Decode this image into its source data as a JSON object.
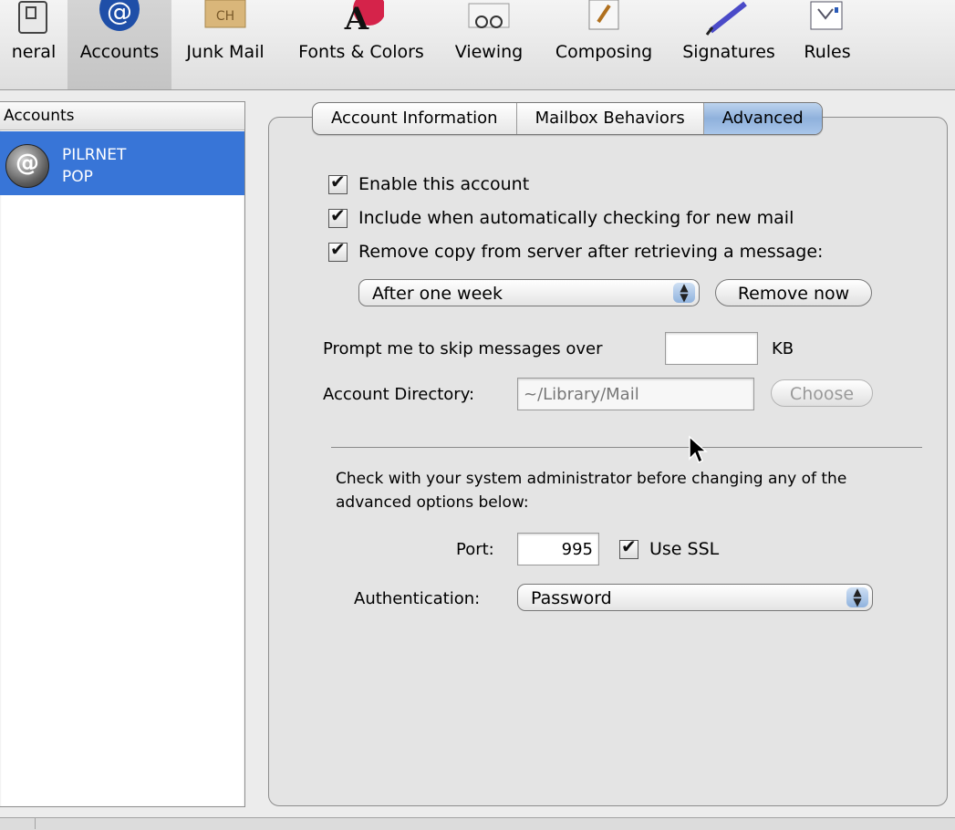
{
  "toolbar": {
    "items": [
      {
        "label": "neral",
        "icon": "general-icon"
      },
      {
        "label": "Accounts",
        "icon": "at-sign-icon",
        "selected": true
      },
      {
        "label": "Junk Mail",
        "icon": "junk-mail-icon"
      },
      {
        "label": "Fonts & Colors",
        "icon": "fonts-colors-icon"
      },
      {
        "label": "Viewing",
        "icon": "glasses-icon"
      },
      {
        "label": "Composing",
        "icon": "pencil-icon"
      },
      {
        "label": "Signatures",
        "icon": "pen-icon"
      },
      {
        "label": "Rules",
        "icon": "rules-icon"
      }
    ]
  },
  "accounts": {
    "header": "Accounts",
    "list": [
      {
        "name": "PILRNET",
        "type": "POP",
        "icon": "at-sign-icon"
      }
    ]
  },
  "tabs": [
    {
      "label": "Account Information"
    },
    {
      "label": "Mailbox Behaviors"
    },
    {
      "label": "Advanced",
      "selected": true
    }
  ],
  "advanced": {
    "enable_account": {
      "label": "Enable this account",
      "checked": true
    },
    "include_auto_check": {
      "label": "Include when automatically checking for new mail",
      "checked": true
    },
    "remove_copy": {
      "label": "Remove copy from server after retrieving a message:",
      "checked": true
    },
    "remove_after_select": {
      "value": "After one week"
    },
    "remove_now_button": "Remove now",
    "prompt_skip": {
      "label": "Prompt me to skip messages over",
      "value": "",
      "unit": "KB"
    },
    "account_directory": {
      "label": "Account Directory:",
      "value": "~/Library/Mail"
    },
    "choose_button": "Choose",
    "admin_note": "Check with your system administrator before changing any of the advanced options below:",
    "port": {
      "label": "Port:",
      "value": "995"
    },
    "use_ssl": {
      "label": "Use SSL",
      "checked": true
    },
    "authentication": {
      "label": "Authentication:",
      "value": "Password"
    }
  },
  "colors": {
    "selection": "#3875d7",
    "tab_selected": "#a9c6ea",
    "window_bg": "#ececec"
  }
}
